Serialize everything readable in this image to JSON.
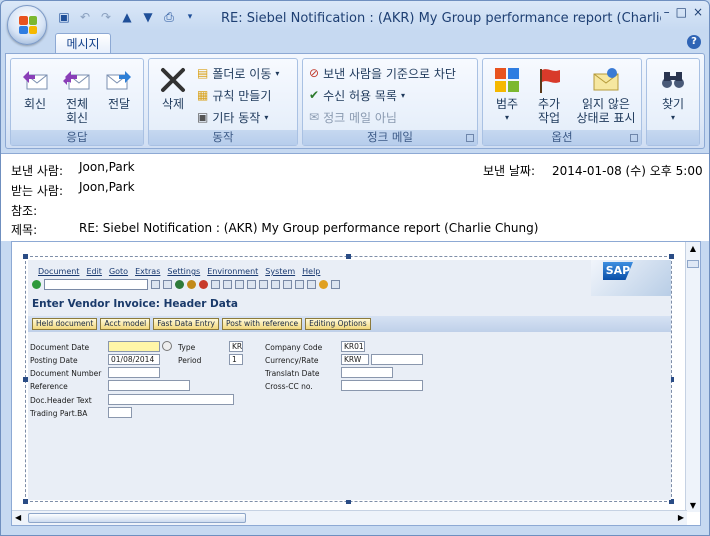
{
  "window": {
    "title": "RE: Siebel Notification : (AKR) My Group performance report (Charlie Chung) 메",
    "controls": [
      "–",
      "□",
      "×"
    ]
  },
  "tabs": [
    {
      "label": "메시지"
    }
  ],
  "ribbon": {
    "groups": [
      {
        "label": "응답",
        "buttons": [
          "회신",
          "전체\n회신",
          "전달"
        ]
      },
      {
        "label": "동작",
        "big": "삭제",
        "items": [
          "폴더로 이동",
          "규칙 만들기",
          "기타 동작"
        ]
      },
      {
        "label": "정크 메일",
        "items": [
          "보낸 사람을 기준으로 차단",
          "수신 허용 목록",
          "정크 메일 아님"
        ]
      },
      {
        "label": "옵션",
        "buttons": [
          "범주",
          "추가\n작업",
          "읽지 않은\n상태로 표시"
        ]
      },
      {
        "label": "",
        "buttons": [
          "찾기"
        ]
      }
    ]
  },
  "header": {
    "from_label": "보낸 사람:",
    "from_value": "Joon,Park",
    "date_label": "보낸 날짜:",
    "date_value": "2014-01-08 (수) 오후 5:00",
    "to_label": "받는 사람:",
    "to_value": "Joon,Park",
    "cc_label": "참조:",
    "subject_label": "제목:",
    "subject_value": "RE: Siebel Notification : (AKR) My Group performance report (Charlie Chung)"
  },
  "sap": {
    "menu": [
      "Document",
      "Edit",
      "Goto",
      "Extras",
      "Settings",
      "Environment",
      "System",
      "Help"
    ],
    "logo": "SAP",
    "screen_title": "Enter Vendor Invoice: Header Data",
    "app_buttons": [
      "Held document",
      "Acct model",
      "Fast Data Entry",
      "Post with reference",
      "Editing Options"
    ],
    "fields": {
      "document_date": "Document Date",
      "type": "Type",
      "type_value": "KR",
      "company_code": "Company Code",
      "company_code_value": "KR01",
      "posting_date": "Posting Date",
      "posting_date_value": "01/08/2014",
      "period": "Period",
      "period_value": "1",
      "currency_rate": "Currency/Rate",
      "currency_value": "KRW",
      "document_number": "Document Number",
      "translatn_date": "Translatn Date",
      "reference": "Reference",
      "cross_cc": "Cross-CC no.",
      "doc_header_text": "Doc.Header Text",
      "trading_part": "Trading Part.BA"
    }
  }
}
